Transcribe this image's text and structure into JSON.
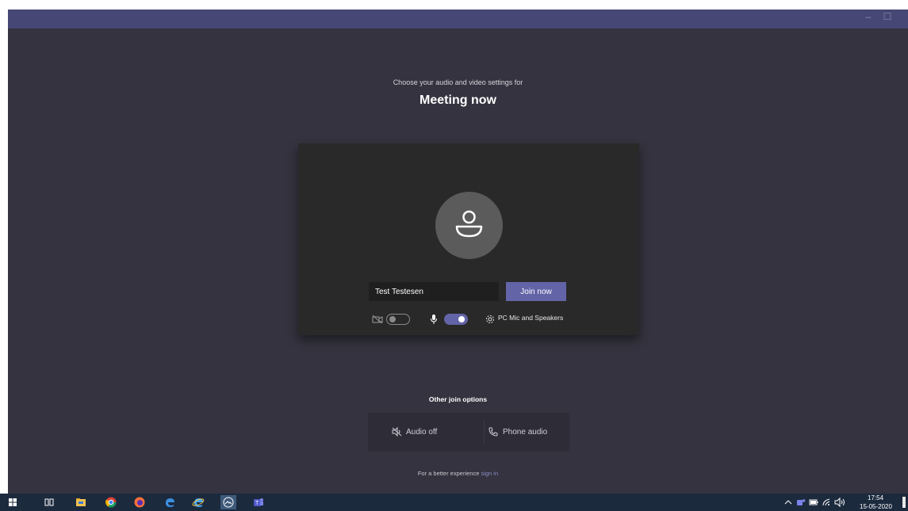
{
  "window": {
    "minimize_glyph": "–",
    "maximize_glyph": "☐"
  },
  "prejoin": {
    "subtitle": "Choose your audio and video settings for",
    "meeting_title": "Meeting now",
    "name_value": "Test Testesen",
    "join_label": "Join now",
    "camera_enabled": false,
    "mic_enabled": true,
    "device_label": "PC Mic and Speakers"
  },
  "other_options": {
    "title": "Other join options",
    "audio_off_label": "Audio off",
    "phone_audio_label": "Phone audio"
  },
  "signin": {
    "prefix": "For a better experience ",
    "link": "sign in"
  },
  "taskbar": {
    "icons": [
      "windows-start-icon",
      "task-view-icon",
      "file-explorer-icon",
      "chrome-icon",
      "firefox-icon",
      "edge-icon",
      "internet-explorer-icon",
      "photos-icon",
      "teams-icon"
    ],
    "time": "17:54",
    "date": "15-05-2020"
  },
  "colors": {
    "accent": "#6264a7",
    "background": "#34333f",
    "card": "#292929",
    "titlebar": "#464775",
    "link": "#8b8cc7"
  }
}
